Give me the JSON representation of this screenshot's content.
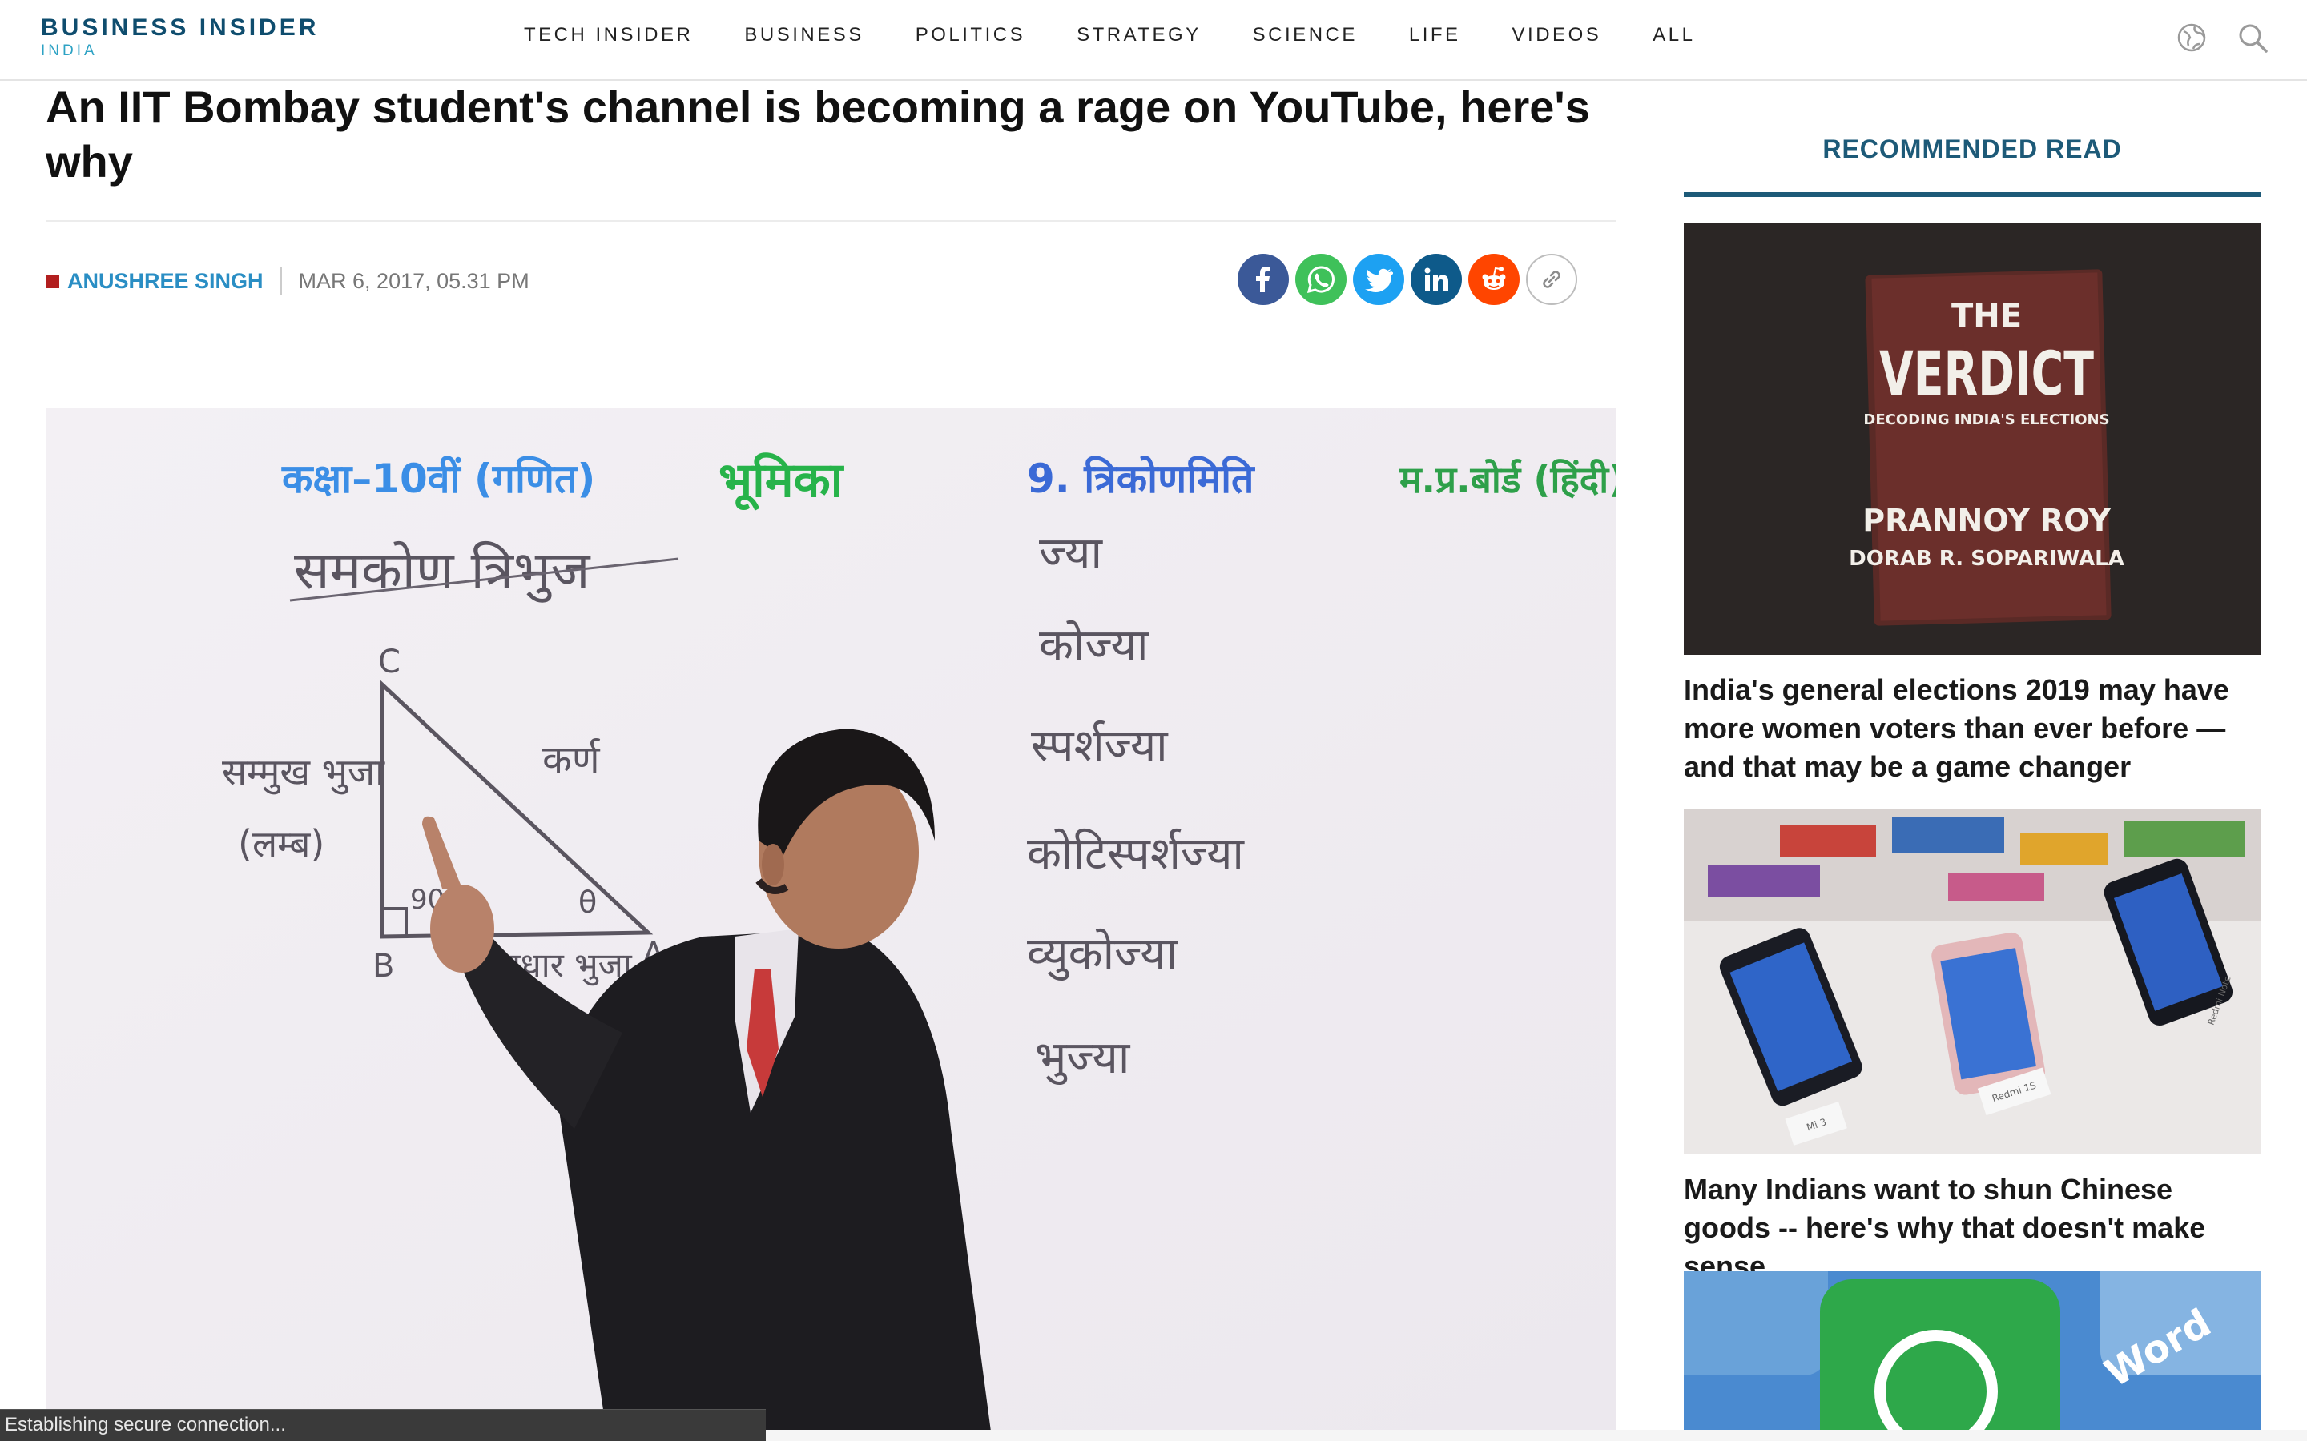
{
  "header": {
    "logo": "BUSINESS INSIDER",
    "logo_sub": "INDIA",
    "nav": [
      {
        "label": "TECH INSIDER"
      },
      {
        "label": "BUSINESS"
      },
      {
        "label": "POLITICS"
      },
      {
        "label": "STRATEGY"
      },
      {
        "label": "SCIENCE"
      },
      {
        "label": "LIFE"
      },
      {
        "label": "VIDEOS"
      },
      {
        "label": "ALL"
      }
    ],
    "icons": [
      "globe-icon",
      "search-icon"
    ]
  },
  "article": {
    "headline": "An IIT Bombay student's channel is becoming a rage on YouTube, here's why",
    "author": "ANUSHREE SINGH",
    "date": "MAR 6, 2017, 05.31 PM",
    "share_icons": [
      "facebook-icon",
      "whatsapp-icon",
      "twitter-icon",
      "linkedin-icon",
      "reddit-icon",
      "link-icon"
    ],
    "hero": {
      "board_top": [
        "कक्षा–10वीं (गणित)",
        "भूमिका",
        "9. त्रिकोणमिति",
        "म.प्र.बोर्ड (हिंदी)"
      ],
      "board_left_title": "समकोण त्रिभुज",
      "triangle_labels": [
        "C",
        "B",
        "A",
        "कर्ण",
        "सम्मुख भुजा",
        "(लम्ब)",
        "90",
        "θ",
        "आधार भुजा"
      ],
      "board_right": [
        "ज्या",
        "कोज्या",
        "स्पर्शज्या",
        "कोटिस्पर्शज्या",
        "व्युकोज्या",
        "भुज्या"
      ]
    }
  },
  "sidebar": {
    "title": "RECOMMENDED READ",
    "cards": [
      {
        "title": "India's general elections 2019 may have more women voters than ever before — and that may be a game changer",
        "book": {
          "line1": "THE",
          "line2": "VERDICT",
          "line3": "DECODING INDIA'S ELECTIONS",
          "line4": "PRANNOY ROY",
          "line5": "DORAB R. SOPARIWALA"
        }
      },
      {
        "title": "Many Indians want to shun Chinese goods -- here's why that doesn't make sense",
        "phone_labels": [
          "Mi 3",
          "Redmi 1S",
          "Redmi Note"
        ]
      },
      {
        "title": "",
        "image_text": "Word"
      }
    ]
  },
  "status": "Establishing secure connection...",
  "colors": {
    "brand": "#0f4d6e",
    "author": "#2a8ec4",
    "section": "#1d5a78"
  }
}
